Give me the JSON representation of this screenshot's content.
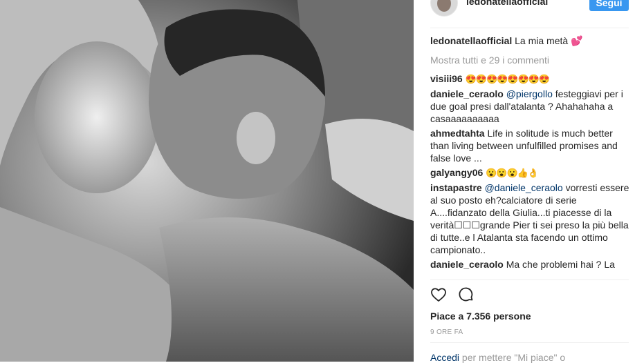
{
  "header": {
    "username": "ledonatellaofficial",
    "follow_label": "Segui"
  },
  "post": {
    "caption_user": "ledonatellaofficial",
    "caption_text": "La mia metà 💕",
    "show_all_comments": "Mostra tutti e 29 i commenti"
  },
  "comments": [
    {
      "user": "visiii96",
      "mention": "",
      "text": "😍😍😍😍😍😍😍😍"
    },
    {
      "user": "daniele_ceraolo",
      "mention": "@piergollo",
      "text": "festeggiavi per i due goal presi dall'atalanta ? Ahahahaha a casaaaaaaaaaa"
    },
    {
      "user": "ahmedtahta",
      "mention": "",
      "text": "Life in solitude is much better than living between unfulfilled promises and false love ..."
    },
    {
      "user": "galyangy06",
      "mention": "",
      "text": "😮😮😮👍👌"
    },
    {
      "user": "instapastre",
      "mention": "@daniele_ceraolo",
      "text": "vorresti essere al suo posto eh?calciatore di serie A....fidanzato della Giulia...ti piacesse di la verità☐☐☐grande Pier ti sei preso la più bella di tutte..e l Atalanta sta facendo un ottimo campionato.."
    },
    {
      "user": "daniele_ceraolo",
      "mention": "",
      "text": "Ma che problemi hai ? La"
    }
  ],
  "likes": "Piace a 7.356 persone",
  "time": "9 ORE FA",
  "login": {
    "link": "Accedi",
    "text": "per mettere \"Mi piace\" o"
  },
  "icons": {
    "heart": "heart-icon",
    "comment": "comment-bubble-icon"
  },
  "colors": {
    "follow_bg": "#3897f0",
    "mention": "#003569",
    "muted": "#999999"
  }
}
